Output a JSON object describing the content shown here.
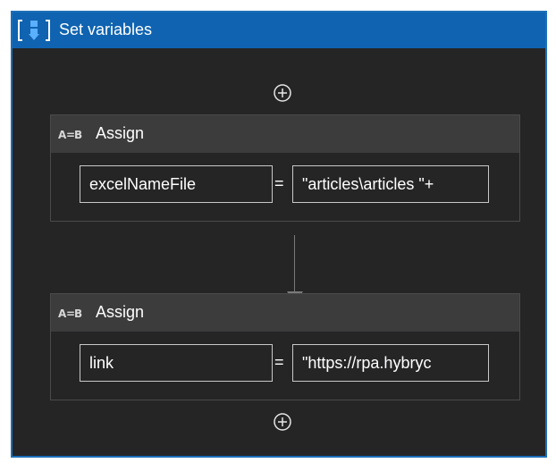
{
  "sequence": {
    "title": "Set variables",
    "icon": "sequence-brackets-icon",
    "accent_color": "#0f63b0"
  },
  "activities": [
    {
      "title": "Assign",
      "icon": "assign-abc-icon",
      "to": "excelNameFile",
      "operator": "=",
      "value": "\"articles\\articles \"+"
    },
    {
      "title": "Assign",
      "icon": "assign-abc-icon",
      "to": "link",
      "operator": "=",
      "value": "\"https://rpa.hybryc"
    }
  ],
  "add_activity_icon": "plus-circle-icon"
}
